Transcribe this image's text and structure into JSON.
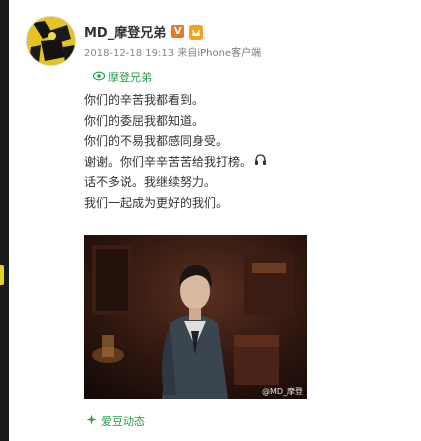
{
  "post": {
    "username": "MD_摩登兄弟",
    "verified_mark": "V",
    "timestamp": "2018-12-18 19:13",
    "source_prefix": "来自",
    "source": "iPhone客户端",
    "topic": "摩登兄弟",
    "lines": [
      "你们的辛苦我都看到。",
      "你们的委屈我都知道。",
      "你们的不易我都感同身受。",
      "谢谢。你们辛辛苦苦给我打榜。",
      "话不多说。我继续努力。",
      "我们一起成为更好的我们。"
    ],
    "image_watermark": "@MD_摩登",
    "footer_label": "爱豆动态"
  },
  "icons": {
    "verified": "verified-badge-icon",
    "member": "member-badge-icon",
    "topic": "topic-eye-icon",
    "emoji": "headphones-emoji-icon",
    "footer": "idol-activity-icon"
  },
  "colors": {
    "topic_green": "#2a9d4a",
    "verified_orange": "#e8792b",
    "member_orange": "#f7a21e"
  }
}
